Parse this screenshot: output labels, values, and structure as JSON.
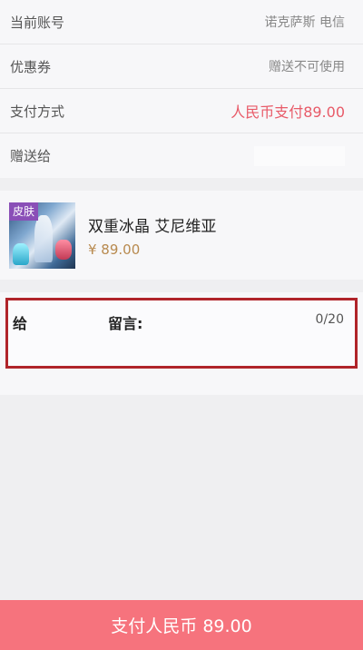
{
  "rows": {
    "account": {
      "label": "当前账号",
      "value": "诺克萨斯 电信"
    },
    "coupon": {
      "label": "优惠券",
      "value": "赠送不可使用"
    },
    "payment": {
      "label": "支付方式",
      "value": "人民币支付89.00"
    },
    "gift_to": {
      "label": "赠送给",
      "value": ""
    }
  },
  "item": {
    "tag": "皮肤",
    "name": "双重冰晶 艾尼维亚",
    "price": "¥ 89.00"
  },
  "message": {
    "to_label": "给",
    "label": "留言:",
    "count": "0/20",
    "placeholder": ""
  },
  "pay_button": {
    "label": "支付人民币 89.00"
  },
  "colors": {
    "accent_price": "#e85a68",
    "pay_button_bg": "#f6737d",
    "item_price": "#b88a4f",
    "highlight_border": "#b0242a"
  }
}
